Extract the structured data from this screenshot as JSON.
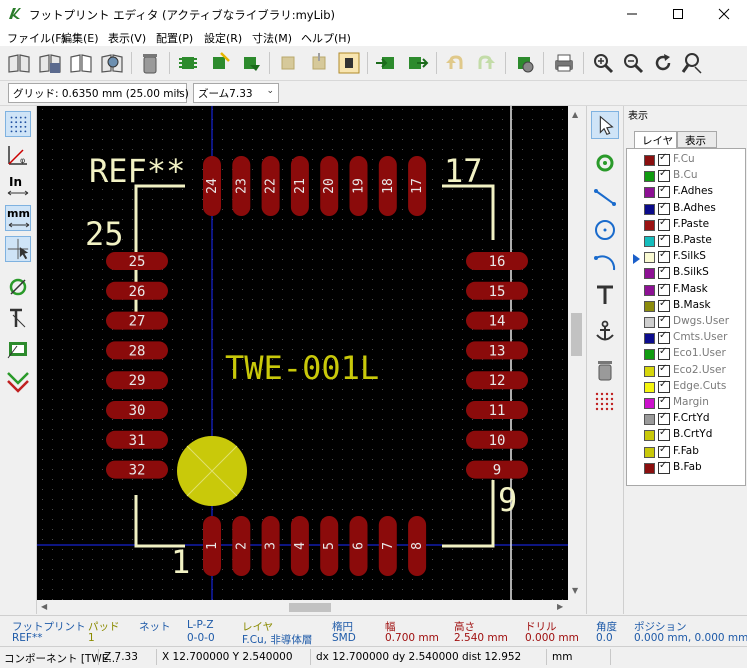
{
  "window": {
    "title": "フットプリント エディタ (アクティブなライブラリ:myLib)"
  },
  "menu": [
    "ファイル(F)",
    "編集(E)",
    "表示(V)",
    "配置(P)",
    "設定(R)",
    "寸法(M)",
    "ヘルプ(H)"
  ],
  "aux": {
    "grid": "グリッド: 0.6350 mm (25.00 mils)",
    "zoom": "ズーム7.33"
  },
  "left_toolbar": {
    "in_label": "In",
    "mm_label": "mm"
  },
  "footprint": {
    "reference": "REF**",
    "value": "TWE-001L",
    "corner_labels": {
      "top_right": "17",
      "left_top": "25",
      "bottom_left": "1",
      "bottom_right": "9"
    },
    "pads_top": [
      "24",
      "23",
      "22",
      "21",
      "20",
      "19",
      "18",
      "17"
    ],
    "pads_bottom": [
      "1",
      "2",
      "3",
      "4",
      "5",
      "6",
      "7",
      "8"
    ],
    "pads_left": [
      "25",
      "26",
      "27",
      "28",
      "29",
      "30",
      "31",
      "32"
    ],
    "pads_right": [
      "16",
      "15",
      "14",
      "13",
      "12",
      "11",
      "10",
      "9"
    ]
  },
  "layers_panel": {
    "title": "表示",
    "tabs": [
      "レイヤ",
      "表示"
    ],
    "active_layer": "F.SilkS",
    "layers": [
      {
        "name": "F.Cu",
        "color": "#8a0f0f",
        "active": false
      },
      {
        "name": "B.Cu",
        "color": "#119c11",
        "active": false
      },
      {
        "name": "F.Adhes",
        "color": "#8d1194",
        "active": true
      },
      {
        "name": "B.Adhes",
        "color": "#0a0a8a",
        "active": true
      },
      {
        "name": "F.Paste",
        "color": "#9b1313",
        "active": true
      },
      {
        "name": "B.Paste",
        "color": "#15bdbd",
        "active": true
      },
      {
        "name": "F.SilkS",
        "color": "#fafad2",
        "active": true
      },
      {
        "name": "B.SilkS",
        "color": "#8d1194",
        "active": true
      },
      {
        "name": "F.Mask",
        "color": "#8d1194",
        "active": true
      },
      {
        "name": "B.Mask",
        "color": "#8c8c0e",
        "active": true
      },
      {
        "name": "Dwgs.User",
        "color": "#cfcfcf",
        "active": false
      },
      {
        "name": "Cmts.User",
        "color": "#0c0c8e",
        "active": false
      },
      {
        "name": "Eco1.User",
        "color": "#119c11",
        "active": false
      },
      {
        "name": "Eco2.User",
        "color": "#d6d60c",
        "active": false
      },
      {
        "name": "Edge.Cuts",
        "color": "#f5f50f",
        "active": false
      },
      {
        "name": "Margin",
        "color": "#cc11cc",
        "active": false
      },
      {
        "name": "F.CrtYd",
        "color": "#9a9a9a",
        "active": true
      },
      {
        "name": "B.CrtYd",
        "color": "#c8c80a",
        "active": true
      },
      {
        "name": "F.Fab",
        "color": "#c8c80a",
        "active": true
      },
      {
        "name": "B.Fab",
        "color": "#8a0f0f",
        "active": true
      }
    ]
  },
  "status_info": {
    "footprint_h": "フットプリント",
    "footprint_v": "REF**",
    "pad_h": "パッド",
    "pad_v": "1",
    "net_h": "ネット",
    "lpz_h": "L-P-Z",
    "lpz_v": "0-0-0",
    "layer_h": "レイヤ",
    "layer_v": "F.Cu, 非導体層",
    "shape_h": "楕円",
    "shape_v": "SMD",
    "width_h": "幅",
    "width_v": "0.700 mm",
    "height_h": "高さ",
    "height_v": "2.540 mm",
    "drill_h": "ドリル",
    "drill_v": "0.000 mm",
    "angle_h": "角度",
    "angle_v": "0.0",
    "position_h": "ポジション",
    "position_v": "0.000 mm, 0.000 mm"
  },
  "status_bar": {
    "component": "コンポーネント [TWE...",
    "zoom": "Z 7.33",
    "xy": "X 12.700000  Y 2.540000",
    "delta": "dx 12.700000  dy 2.540000  dist 12.952",
    "units": "mm"
  },
  "colors": {
    "pad": "#8b0b0b",
    "silk": "#f2f2c4",
    "fab": "#c9c90a",
    "cursor_line": "#1a2aff"
  }
}
